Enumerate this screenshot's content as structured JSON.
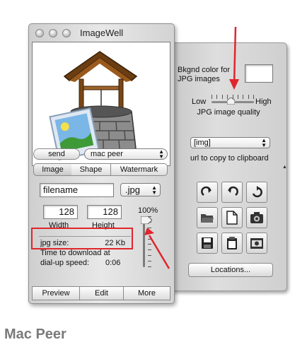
{
  "window": {
    "title": "ImageWell"
  },
  "send": {
    "button": "send",
    "target": "mac peer"
  },
  "tabs": [
    "Image",
    "Shape",
    "Watermark"
  ],
  "file": {
    "name": "filename",
    "format": ".jpg"
  },
  "size": {
    "width": "128",
    "height": "128",
    "width_label": "Width",
    "height_label": "Height"
  },
  "slider": {
    "percent_label": "100%",
    "level": 1.0
  },
  "info": {
    "jpg_size_label": "jpg size:",
    "jpg_size_value": "22 Kb",
    "download_line1": "Time to download at",
    "download_line2_label": "dial-up speed:",
    "download_time": "0:06"
  },
  "bottom_buttons": [
    "Preview",
    "Edit",
    "More"
  ],
  "drawer": {
    "bg_label_line1": "Bkgnd color for",
    "bg_label_line2": "JPG images",
    "quality_low": "Low",
    "quality_high": "High",
    "quality_label": "JPG image quality",
    "quality_level": 0.45,
    "tag_value": "[img]",
    "tag_caption": "url to copy to clipboard",
    "locations_button": "Locations..."
  },
  "caption": "Mac Peer",
  "colors": {
    "annotation": "#e0262c",
    "caption": "#7a7a7a"
  }
}
